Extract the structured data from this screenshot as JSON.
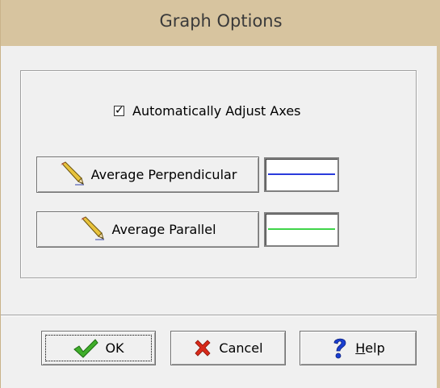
{
  "window": {
    "title": "Graph Options"
  },
  "options": {
    "auto_adjust_axes": {
      "label": "Automatically Adjust Axes",
      "checked": true
    }
  },
  "lines": [
    {
      "label": "Average Perpendicular",
      "color": "#2a3bdc",
      "icon": "pencil-icon"
    },
    {
      "label": "Average Parallel",
      "color": "#3fd44a",
      "icon": "pencil-icon"
    }
  ],
  "buttons": {
    "ok": {
      "label": "OK",
      "icon": "checkmark-icon"
    },
    "cancel": {
      "label": "Cancel",
      "icon": "x-icon"
    },
    "help": {
      "label_first": "H",
      "label_rest": "elp",
      "icon": "question-icon"
    }
  }
}
